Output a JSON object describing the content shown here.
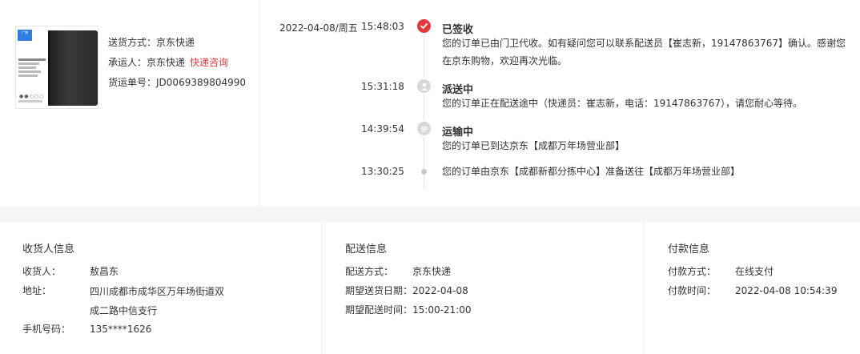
{
  "shipping": {
    "method_label": "送货方式：",
    "method_value": "京东快递",
    "carrier_label": "承运人：",
    "carrier_value": "京东快递",
    "carrier_link": "快递咨询",
    "tracking_label": "货运单号：",
    "tracking_value": "JD0069389804990"
  },
  "product_image": {
    "alt_icon": "notebook-product-image",
    "badge": "广博",
    "dots": "●●○○○"
  },
  "timeline": [
    {
      "date": "2022-04-08/周五",
      "time": "15:48:03",
      "icon": "check-icon",
      "status": "已签收",
      "desc": "您的订单已由门卫代收。如有疑问您可以联系配送员【崔志新，19147863767】确认。感谢您在京东购物，欢迎再次光临。"
    },
    {
      "date": "",
      "time": "15:31:18",
      "icon": "delivery-person-icon",
      "status": "派送中",
      "desc": "您的订单正在配送途中（快递员：崔志新，电话：19147863767），请您耐心等待。"
    },
    {
      "date": "",
      "time": "14:39:54",
      "icon": "transport-icon",
      "status": "运输中",
      "desc": "您的订单已到达京东【成都万年场营业部】"
    },
    {
      "date": "",
      "time": "13:30:25",
      "icon": "dot-icon",
      "status": "",
      "desc": "您的订单由京东【成都新都分拣中心】准备送往【成都万年场营业部】"
    }
  ],
  "recipient": {
    "title": "收货人信息",
    "name_label": "收货人：",
    "name_value": "敖昌东",
    "address_label": "地址：",
    "address_value": "四川成都市成华区万年场街道双成二路中信支行",
    "phone_label": "手机号码：",
    "phone_value": "135****1626"
  },
  "delivery": {
    "title": "配送信息",
    "method_label": "配送方式：",
    "method_value": "京东快递",
    "date_label": "期望送货日期：",
    "date_value": "2022-04-08",
    "time_label": "期望配送时间：",
    "time_value": "15:00-21:00"
  },
  "payment": {
    "title": "付款信息",
    "method_label": "付款方式：",
    "method_value": "在线支付",
    "time_label": "付款时间：",
    "time_value": "2022-04-08 10:54:39"
  },
  "colors": {
    "accent": "#e4393c",
    "separator": "#f5f5f5",
    "node_gray": "#d8d8d8"
  }
}
